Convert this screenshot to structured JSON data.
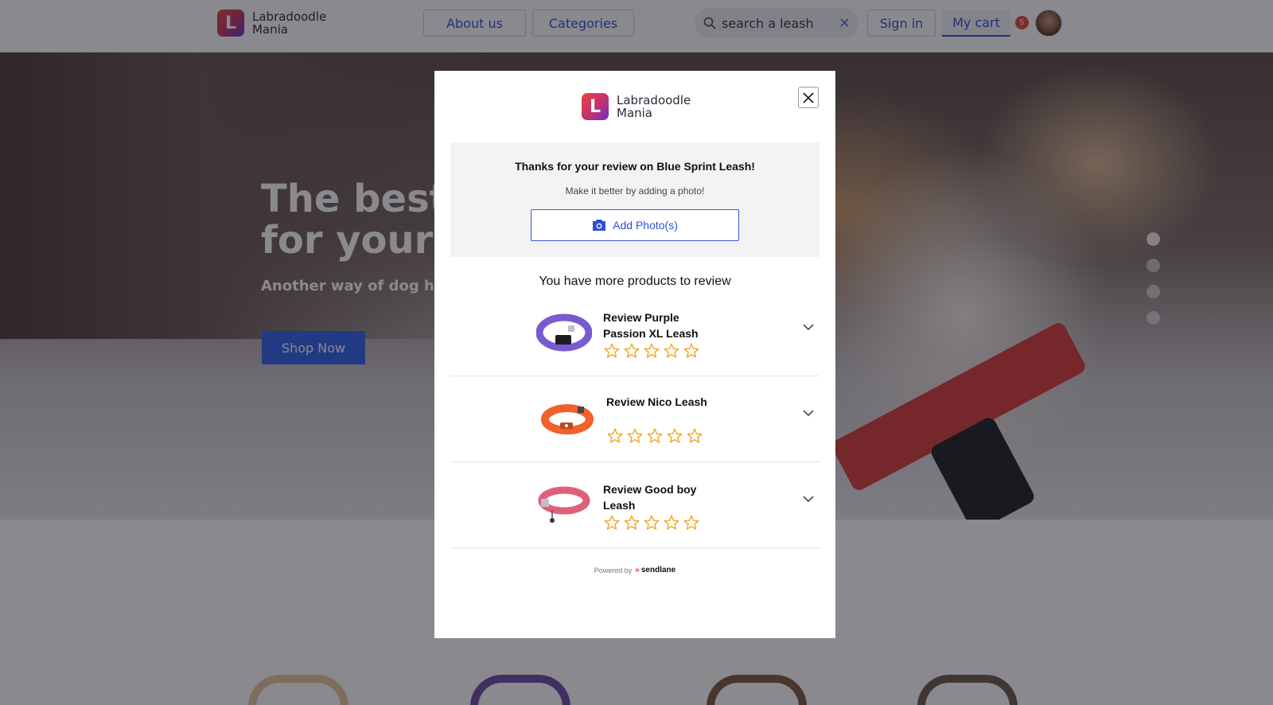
{
  "brand": {
    "line1": "Labradoodle",
    "line2": "Mania",
    "mark": "L",
    "gradient": [
      "#e8453c",
      "#6a2fc7"
    ]
  },
  "header": {
    "nav": {
      "about_label": "About us",
      "categories_label": "Categories"
    },
    "search": {
      "value": "search a leash",
      "clear_icon": "close-icon",
      "icon": "search-icon"
    },
    "signin_label": "Sign in",
    "cart_label": "My cart",
    "cart_count": "5",
    "accent_color": "#2f4fd8"
  },
  "hero": {
    "title_line1": "The best",
    "title_line2": "for your",
    "subtitle": "Another way of dog ha",
    "cta_label": "Shop Now",
    "slide_count": 4,
    "active_slide": 1
  },
  "modal": {
    "thanks_title": "Thanks for your review on Blue Sprint Leash!",
    "thanks_sub": "Make it better by adding a photo!",
    "add_photo_label": "Add Photo(s)",
    "more_title": "You have more products to review",
    "reviews": [
      {
        "name_line1": "Review Purple",
        "name_line2": "Passion XL Leash",
        "rating": 0,
        "max_rating": 5,
        "color": "#7a5ad0"
      },
      {
        "name_line1": "Review Nico Leash",
        "name_line2": "",
        "rating": 0,
        "max_rating": 5,
        "color": "#f0622a"
      },
      {
        "name_line1": "Review Good boy",
        "name_line2": "Leash",
        "rating": 0,
        "max_rating": 5,
        "color": "#e0607a"
      }
    ],
    "powered_by": "Powered by",
    "powered_brand": "sendlane",
    "star_color": "#f0a020"
  }
}
